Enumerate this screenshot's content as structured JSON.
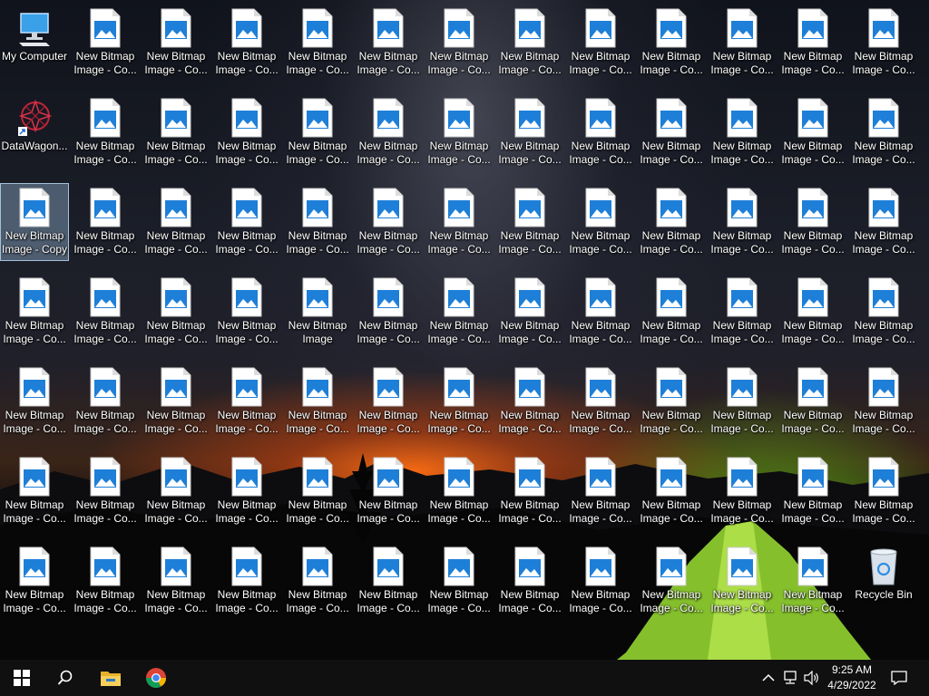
{
  "desktop": {
    "my_computer": "My Computer",
    "datawagon": "DataWagon...",
    "recycle_bin": "Recycle Bin",
    "bitmap_label_truncated": "New Bitmap\nImage - Co...",
    "bitmap_label_copy": "New Bitmap\nImage - Copy",
    "bitmap_label_plain": "New Bitmap\nImage"
  },
  "taskbar": {
    "start_icon": "windows-logo-icon",
    "search_icon": "search-icon",
    "explorer_icon": "file-explorer-icon",
    "chrome_icon": "chrome-icon"
  },
  "tray": {
    "chevron_icon": "chevron-up-icon",
    "network_icon": "network-icon",
    "volume_icon": "volume-icon",
    "notification_icon": "notification-icon"
  },
  "clock": {
    "time": "9:25 AM",
    "date": "4/29/2022"
  },
  "colors": {
    "taskbar": "#101010",
    "selection": "#8caac8",
    "bitmap_blue": "#1e7fd8"
  }
}
